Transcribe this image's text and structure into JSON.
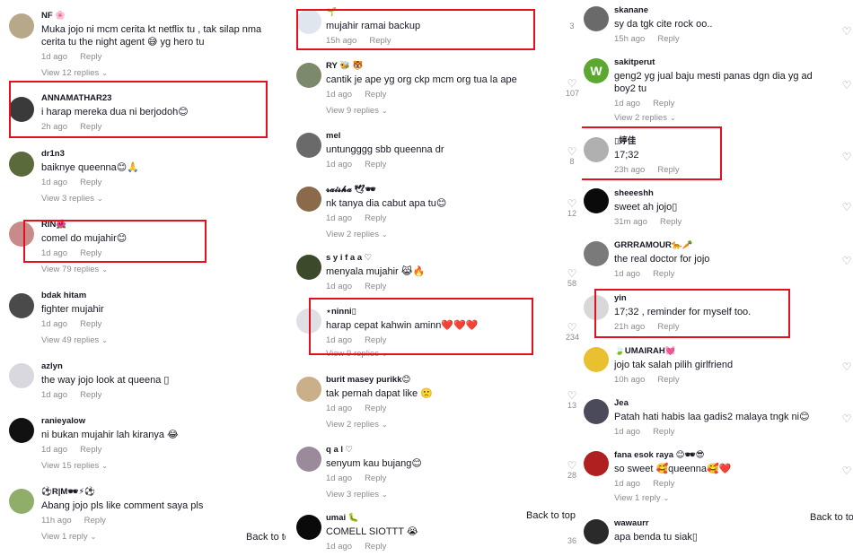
{
  "columns": [
    {
      "comments": [
        {
          "user": "NF 🌸",
          "text": "Muka jojo ni mcm cerita kt netflix tu , tak silap nma cerita tu the night agent 😅 yg hero tu",
          "time": "1d ago",
          "reply": "Reply",
          "replies": "View 12 replies",
          "avatar": "#b8a88a"
        },
        {
          "user": "ANNAMATHAR23",
          "text": "i harap mereka dua ni berjodoh😊",
          "time": "2h ago",
          "reply": "Reply",
          "avatar": "#3a3a3a"
        },
        {
          "user": "dr1n3",
          "text": "baiknye queenna😊🙏",
          "time": "1d ago",
          "reply": "Reply",
          "replies": "View 3 replies",
          "avatar": "#5a6a3a"
        },
        {
          "user": "RIN🌺",
          "text": "comel do mujahir😊",
          "time": "1d ago",
          "reply": "Reply",
          "replies": "View 79 replies",
          "avatar": "#c98a8a"
        },
        {
          "user": "bdak hitam",
          "text": "fighter mujahir",
          "time": "1d ago",
          "reply": "Reply",
          "replies": "View 49 replies",
          "avatar": "#4a4a4a"
        },
        {
          "user": "azlyn",
          "text": "the way jojo look at queena ▯",
          "time": "1d ago",
          "reply": "Reply",
          "avatar": "#d8d8de"
        },
        {
          "user": "ranieyalow",
          "text": "ni bukan mujahir lah kiranya 😂",
          "time": "1d ago",
          "reply": "Reply",
          "replies": "View 15 replies",
          "avatar": "#111111"
        },
        {
          "user": "⚽R|M🕶⚡⚽",
          "text": "Abang jojo pls like comment saya pls",
          "time": "11h ago",
          "reply": "Reply",
          "replies": "View 1 reply",
          "avatar": "#8fae6a"
        }
      ],
      "back_to_top": "Back to top"
    },
    {
      "comments": [
        {
          "user": "🌱",
          "text": "mujahir ramai backup",
          "time": "15h ago",
          "reply": "Reply",
          "avatar": "#dfe6ee"
        },
        {
          "user": "RY 🐝 🐯",
          "text": "cantik je ape yg org ckp mcm org tua la ape",
          "time": "1d ago",
          "reply": "Reply",
          "replies": "View 9 replies",
          "avatar": "#7a8a6a"
        },
        {
          "user": "mel",
          "text": "untungggg sbb queenna dr",
          "time": "1d ago",
          "reply": "Reply",
          "avatar": "#6a6a6a"
        },
        {
          "user": "𝓻𝓪𝓲𝓼𝓱𝓪 🕊🕶",
          "text": "nk tanya dia cabut apa tu😊",
          "time": "1d ago",
          "reply": "Reply",
          "replies": "View 2 replies",
          "avatar": "#8a6a4a"
        },
        {
          "user": "s y i f a a ♡",
          "text": "menyala mujahir 😹🔥",
          "time": "1d ago",
          "reply": "Reply",
          "avatar": "#3a4a2a"
        },
        {
          "user": "⋆ninni▯",
          "text": "harap cepat kahwin aminn❤️❤️❤️",
          "time": "1d ago",
          "reply": "Reply",
          "replies": "View 9 replies",
          "avatar": "#e0e0e4"
        },
        {
          "user": "burit masey purikk😊",
          "text": "tak pernah dapat like 🙁",
          "time": "1d ago",
          "reply": "Reply",
          "replies": "View 2 replies",
          "avatar": "#c9b08a"
        },
        {
          "user": "q a l ♡",
          "text": "senyum kau bujang😊",
          "time": "1d ago",
          "reply": "Reply",
          "replies": "View 3 replies",
          "avatar": "#9a8a9a"
        },
        {
          "user": "umai 🐛",
          "text": "COMELL SIOTTT 😭",
          "time": "1d ago",
          "reply": "Reply",
          "avatar": "#0a0a0a"
        }
      ],
      "back_to_top": "Back to top"
    },
    {
      "comments": [
        {
          "user": "skanane",
          "text": "sy da tgk cite rock oo..",
          "time": "15h ago",
          "reply": "Reply",
          "avatar": "#6a6a6a"
        },
        {
          "user": "sakitperut",
          "text": "geng2 yg jual baju mesti panas dgn dia yg ad boy2 tu",
          "time": "1d ago",
          "reply": "Reply",
          "replies": "View 2 replies",
          "avatar": "#5aa830",
          "initial": "W"
        },
        {
          "user": "▯婷佳",
          "text": "17;32",
          "time": "23h ago",
          "reply": "Reply",
          "avatar": "#b0b0b0"
        },
        {
          "user": "sheeeshh",
          "text": "sweet ah jojo▯",
          "time": "31m ago",
          "reply": "Reply",
          "avatar": "#0a0a0a"
        },
        {
          "user": "GRRRAMOUR🐆🥕",
          "text": "the real doctor for jojo",
          "time": "1d ago",
          "reply": "Reply",
          "avatar": "#7a7a7a"
        },
        {
          "user": "yin",
          "text": "17;32 , reminder for myself too.",
          "time": "21h ago",
          "reply": "Reply",
          "avatar": "#d8d8d8"
        },
        {
          "user": "🍃UMAIRAH💓",
          "text": "jojo tak salah pilih girlfriend",
          "time": "10h ago",
          "reply": "Reply",
          "avatar": "#e8c030"
        },
        {
          "user": "Jea",
          "text": "Patah hati habis laa gadis2 malaya tngk ni😊",
          "time": "1d ago",
          "reply": "Reply",
          "avatar": "#4a4a5a"
        },
        {
          "user": "fana esok raya 😊🕶😎",
          "text": "so sweet 🥰queenna🥰❤️",
          "time": "1d ago",
          "reply": "Reply",
          "replies": "View 1 reply",
          "avatar": "#b02020"
        },
        {
          "user": "wawaurr",
          "text": "apa benda tu siak▯",
          "time": "",
          "reply": "",
          "avatar": "#2a2a2a"
        }
      ],
      "back_to_top": "Back to top"
    }
  ],
  "rail_counts": {
    "c1": [
      "3",
      "107",
      "8",
      "12",
      "58",
      "234",
      "13",
      "28",
      "36"
    ],
    "c2": [
      "▯"
    ],
    "c3": []
  },
  "colors": {
    "highlight": "#e3101e",
    "muted": "#8a8b91",
    "text": "#161823"
  }
}
